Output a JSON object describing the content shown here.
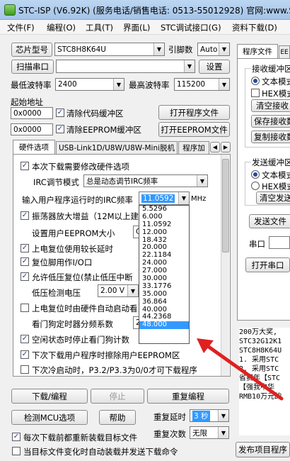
{
  "title": "STC-ISP (V6.92K) (服务电话/销售电话: 0513-55012928) 官网:www.ST",
  "menu": [
    "文件(F)",
    "编程(O)",
    "工具(T)",
    "界面(L)",
    "STC调试接口(G)",
    "资料下载(D)"
  ],
  "left": {
    "chip_label": "芯片型号",
    "chip_value": "STC8H8K64U",
    "pin_label": "引脚数",
    "pin_value": "Auto",
    "scan_label": "扫描串口",
    "settings_label": "设置",
    "min_baud_label": "最低波特率",
    "min_baud_value": "2400",
    "max_baud_label": "最高波特率",
    "max_baud_value": "115200",
    "start_addr_label": "起始地址",
    "addr1_value": "0x0000",
    "clear_code_label": "清除代码缓冲区",
    "open_prog_label": "打开程序文件",
    "addr2_value": "0x0000",
    "clear_eeprom_label": "清除EEPROM缓冲区",
    "open_eeprom_label": "打开EEPROM文件"
  },
  "tabs": [
    "硬件选项",
    "USB-Link1D/U8W/U8W-Mini脱机",
    "程序加"
  ],
  "hw": {
    "modify_hw": "本次下载需要修改硬件选项",
    "irc_mode_label": "IRC调节模式",
    "irc_mode_value": "总是动态调节IRC频率",
    "irc_freq_label": "输入用户程序运行时的IRC频率",
    "irc_freq_value": "11.0592",
    "irc_freq_unit": "MHz",
    "osc_gain": "振荡器放大增益（12M以上建议",
    "eeprom_size_label": "设置用户EEPROM大小",
    "eeprom_size_value": "C",
    "power_delay": "上电复位使用较长延时",
    "reset_io": "复位脚用作I/O口",
    "low_voltage": "允许低压复位(禁止低压中断",
    "lv_detect_label": "低压检测电压",
    "lv_value": "2.00 V",
    "hw_wdt": "上电复位时由硬件自动启动看",
    "wdt_div_label": "看门狗定时器分频系数",
    "wdt_div_value": "2",
    "idle_wdt": "空闲状态时停止看门狗计数",
    "erase_eeprom": "下次下载用户程序时擦除用户EEPROM区",
    "cold_start": "下次冷启动时，P3.2/P3.3为0/0才可下载程序"
  },
  "dropdown_options": [
    "5.5296",
    "6.000",
    "11.0592",
    "12.000",
    "18.432",
    "20.000",
    "22.1184",
    "24.000",
    "27.000",
    "30.000",
    "33.1776",
    "35.000",
    "36.864",
    "40.000",
    "44.2368",
    "48.000"
  ],
  "dropdown_selected": "48.000",
  "bottom": {
    "download_label": "下载/编程",
    "stop_label": "停止",
    "reprogram_label": "重复编程",
    "check_mcu_label": "检测MCU选项",
    "help_label": "帮助",
    "repeat_delay_label": "重复延时",
    "repeat_delay_value": "3 秒",
    "repeat_count_label": "重复次数",
    "repeat_count_value": "无限",
    "reload_each": "每次下载前都重新装载目标文件",
    "auto_send": "当目标文件变化时自动装载并发送下载命令"
  },
  "right": {
    "tab1": "程序文件",
    "tab2": "EE",
    "recv_label": "接收缓冲区",
    "text_mode": "文本模式",
    "hex_mode": "HEX模式",
    "clear_recv": "清空接收",
    "save_recv": "保存接收数",
    "copy_recv": "复制接收数",
    "send_label": "发送缓冲区",
    "send_text": "文本模式",
    "send_hex": "HEX模式",
    "clear_send": "清空发送",
    "send_file": "发送文件",
    "port_label": "串口",
    "open_port": "打开串口",
    "publish": "发布项目程序"
  },
  "console_lines": [
    "200万大奖,",
    "STC32G12K1",
    "STC8H8K64U",
    "1. 采用STC",
    "2. 采用STC",
    "省赛年【STC",
    "【强我中华",
    "RMB10万元的"
  ],
  "highlight_color": "#3399ff",
  "arrow_color": "#e02020"
}
